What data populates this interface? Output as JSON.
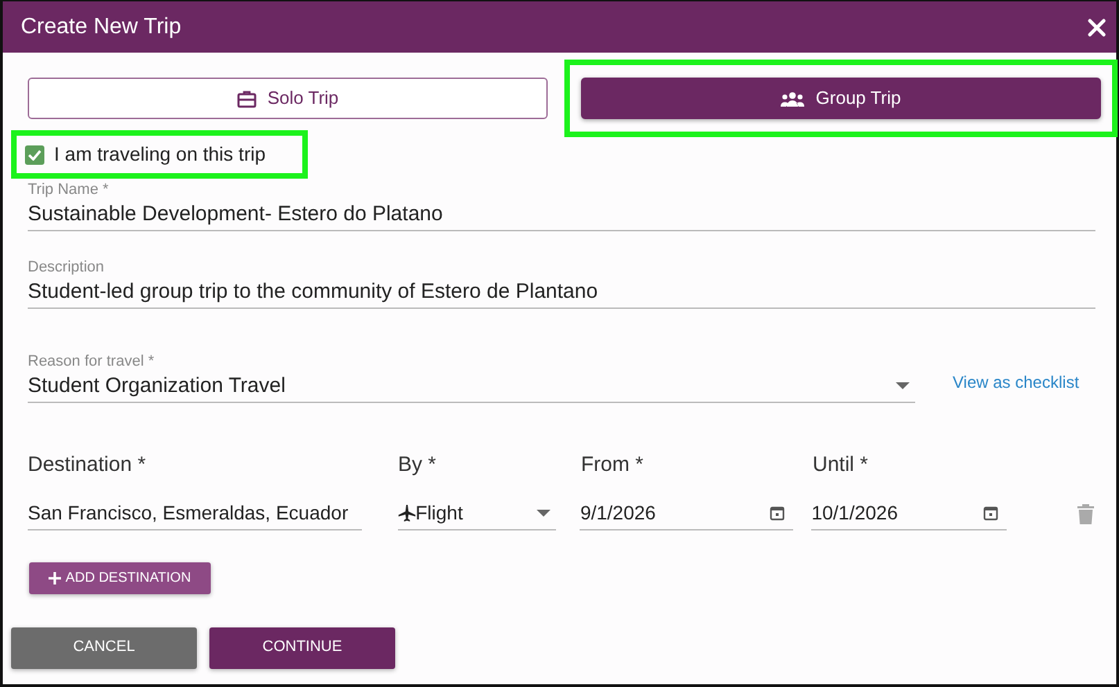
{
  "dialog": {
    "title": "Create New Trip"
  },
  "trip_types": [
    {
      "label": "Solo Trip",
      "kind": "solo",
      "selected": false,
      "highlighted": false
    },
    {
      "label": "Group Trip",
      "kind": "group",
      "selected": true,
      "highlighted": true
    }
  ],
  "traveling_checkbox": {
    "label": "I am traveling on this trip",
    "checked": true,
    "highlighted": true
  },
  "fields": [
    {
      "label": "Trip Name *",
      "value": "Sustainable Development- Estero do Platano"
    },
    {
      "label": "Description",
      "value": "Student-led group trip to the community of Estero de Plantano"
    }
  ],
  "reason": {
    "label": "Reason for travel *",
    "value": "Student Organization Travel",
    "link": "View as checklist"
  },
  "destinations": {
    "columns": [
      "Destination *",
      "By *",
      "From *",
      "Until *"
    ],
    "rows": [
      {
        "destination": "San Francisco, Esmeraldas, Ecuador",
        "by": "Flight",
        "from": "9/1/2026",
        "until": "10/1/2026"
      }
    ]
  },
  "add_destination": "ADD DESTINATION",
  "buttons": [
    {
      "label": "CANCEL",
      "kind": "secondary"
    },
    {
      "label": "CONTINUE",
      "kind": "primary"
    }
  ]
}
